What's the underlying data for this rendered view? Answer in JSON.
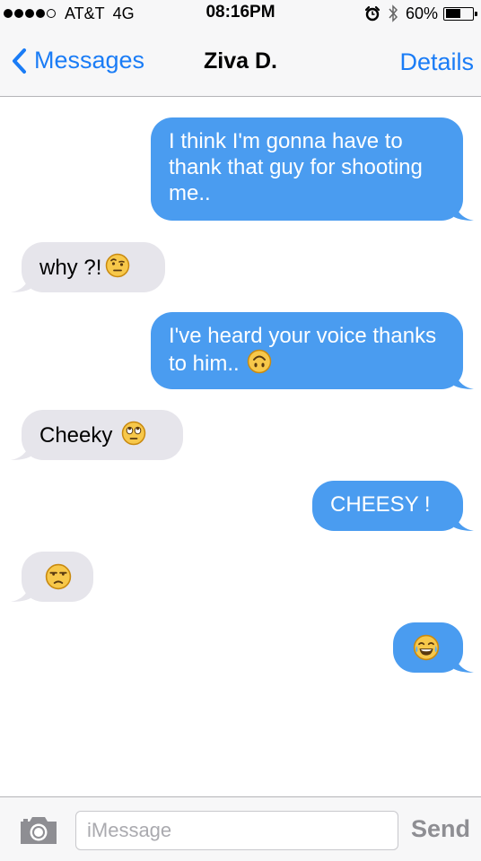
{
  "status_bar": {
    "carrier": "AT&T",
    "network": "4G",
    "time": "08:16PM",
    "battery_percent": "60%",
    "battery_level": 0.6,
    "signal_bars": 4
  },
  "nav": {
    "back_label": "Messages",
    "contact_name": "Ziva D.",
    "details_label": "Details",
    "accent_color": "#1a7cf6"
  },
  "messages": [
    {
      "direction": "outgoing",
      "text": "I think I'm gonna have to thank that guy for shooting me..",
      "emoji": ""
    },
    {
      "direction": "incoming",
      "text": "why ?!",
      "emoji": "face-with-raised-eyebrow"
    },
    {
      "direction": "outgoing",
      "text": "I've heard your voice thanks to him..",
      "emoji": "upside-down-face"
    },
    {
      "direction": "incoming",
      "text": "Cheeky",
      "emoji": "face-with-rolling-eyes"
    },
    {
      "direction": "outgoing",
      "text": "CHEESY !",
      "emoji": ""
    },
    {
      "direction": "incoming",
      "text": "",
      "emoji": "unamused-face"
    },
    {
      "direction": "outgoing",
      "text": "",
      "emoji": "face-with-tears-of-joy"
    }
  ],
  "colors": {
    "outgoing_bubble": "#4a9cf0",
    "incoming_bubble": "#e6e5eb"
  },
  "compose": {
    "placeholder": "iMessage",
    "value": "",
    "send_label": "Send"
  }
}
